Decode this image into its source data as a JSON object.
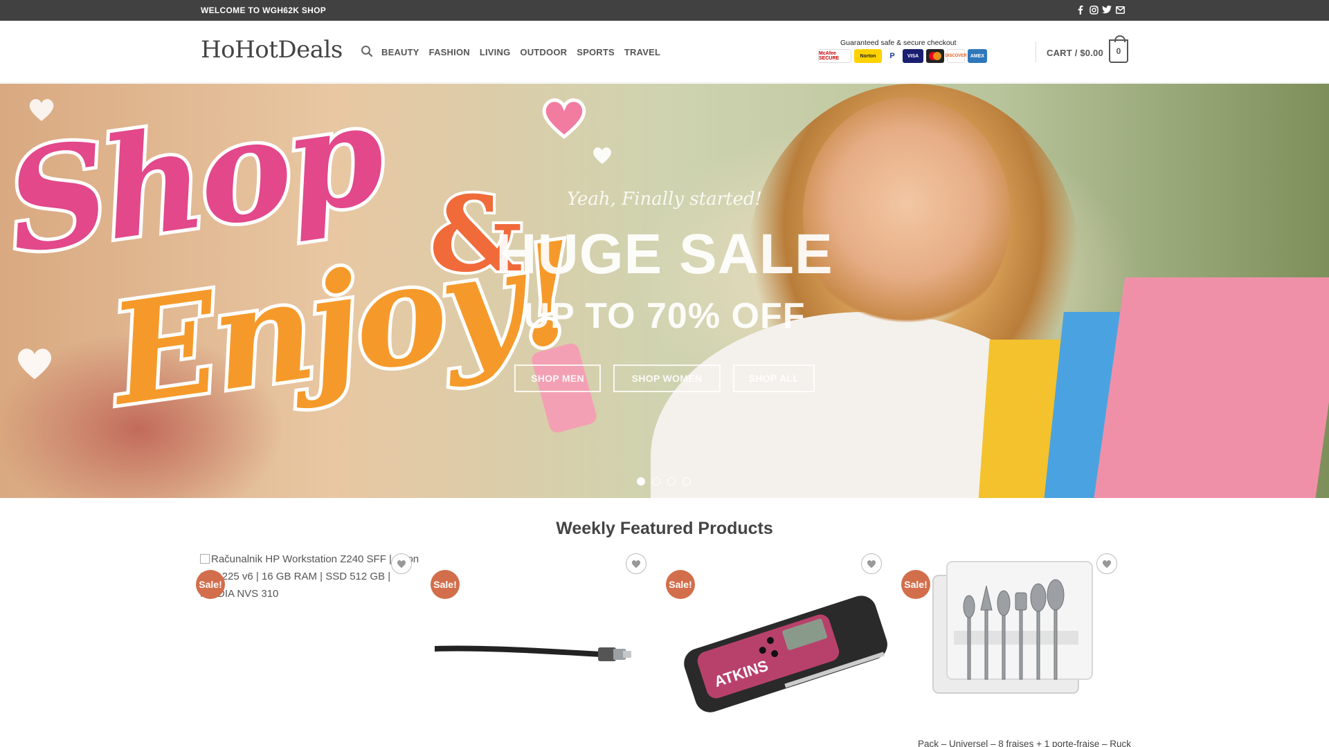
{
  "topbar": {
    "welcome": "WELCOME TO WGH62K SHOP",
    "social_icons": [
      "facebook-icon",
      "instagram-icon",
      "twitter-icon",
      "email-icon"
    ]
  },
  "header": {
    "logo": "HoHotDeals",
    "nav": [
      "BEAUTY",
      "FASHION",
      "LIVING",
      "OUTDOOR",
      "SPORTS",
      "TRAVEL"
    ],
    "secure_caption": "Guaranteed safe & secure checkout",
    "payment_badges": [
      "McAfee SECURE",
      "Norton",
      "P",
      "VISA",
      "",
      "DISCOVER",
      "AMEX"
    ],
    "cart_label": "CART / $0.00",
    "cart_count": "0"
  },
  "hero": {
    "tagline": "Yeah, Finally started!",
    "title": "HUGE SALE",
    "subtitle": "UP TO 70% OFF",
    "buttons": [
      "SHOP MEN",
      "SHOP WOMEN",
      "SHOP ALL"
    ],
    "artwork_text": [
      "Shop",
      "&",
      "Enjoy!"
    ],
    "slide_count": 4,
    "active_slide": 1
  },
  "featured": {
    "title": "Weekly Featured Products",
    "sale_badge": "Sale!",
    "products": [
      {
        "alt_text": "Računalnik HP Workstation Z240 SFF | Xeon E3-1225 v6 | 16 GB RAM | SSD 512 GB | NVIDIA NVS 310",
        "name": ""
      },
      {
        "alt_text": "",
        "name": ""
      },
      {
        "alt_text": "",
        "name": ""
      },
      {
        "alt_text": "",
        "name": "Pack – Universel – 8 fraises + 1 porte-fraise – Ruck"
      }
    ]
  },
  "colors": {
    "topbar_bg": "#414141",
    "sale_badge": "#d26e4b",
    "text": "#555555"
  }
}
